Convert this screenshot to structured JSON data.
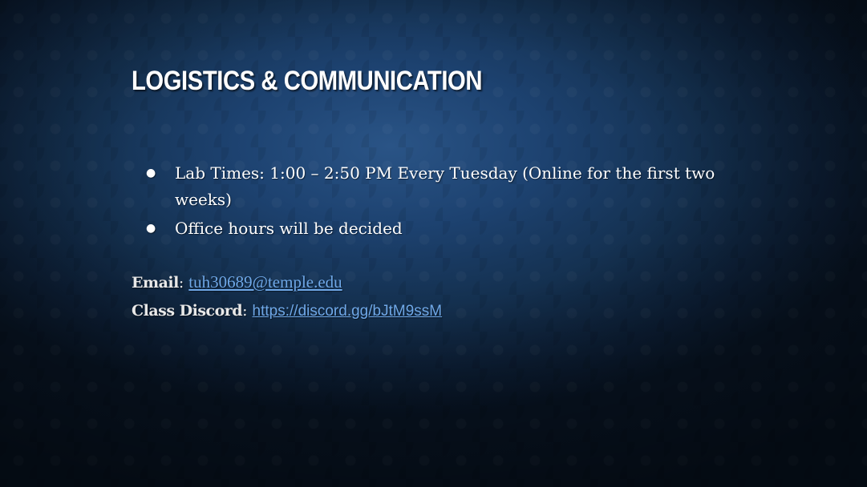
{
  "slide": {
    "title": "Logistics & Communication",
    "bullets": [
      "Lab Times: 1:00 – 2:50 PM Every Tuesday (Online for the first two weeks)",
      "Office hours will be decided"
    ],
    "bullet_marker": "●",
    "contact": {
      "email_label": "Email",
      "email_value": "tuh30689@temple.edu",
      "discord_label": "Class Discord",
      "discord_value": "https://discord.gg/bJtM9ssM",
      "separator": ": "
    }
  },
  "colors": {
    "background_center": "#2a5486",
    "background_edge": "#081423",
    "link": "#6fa8e8",
    "text": "#ffffff"
  }
}
